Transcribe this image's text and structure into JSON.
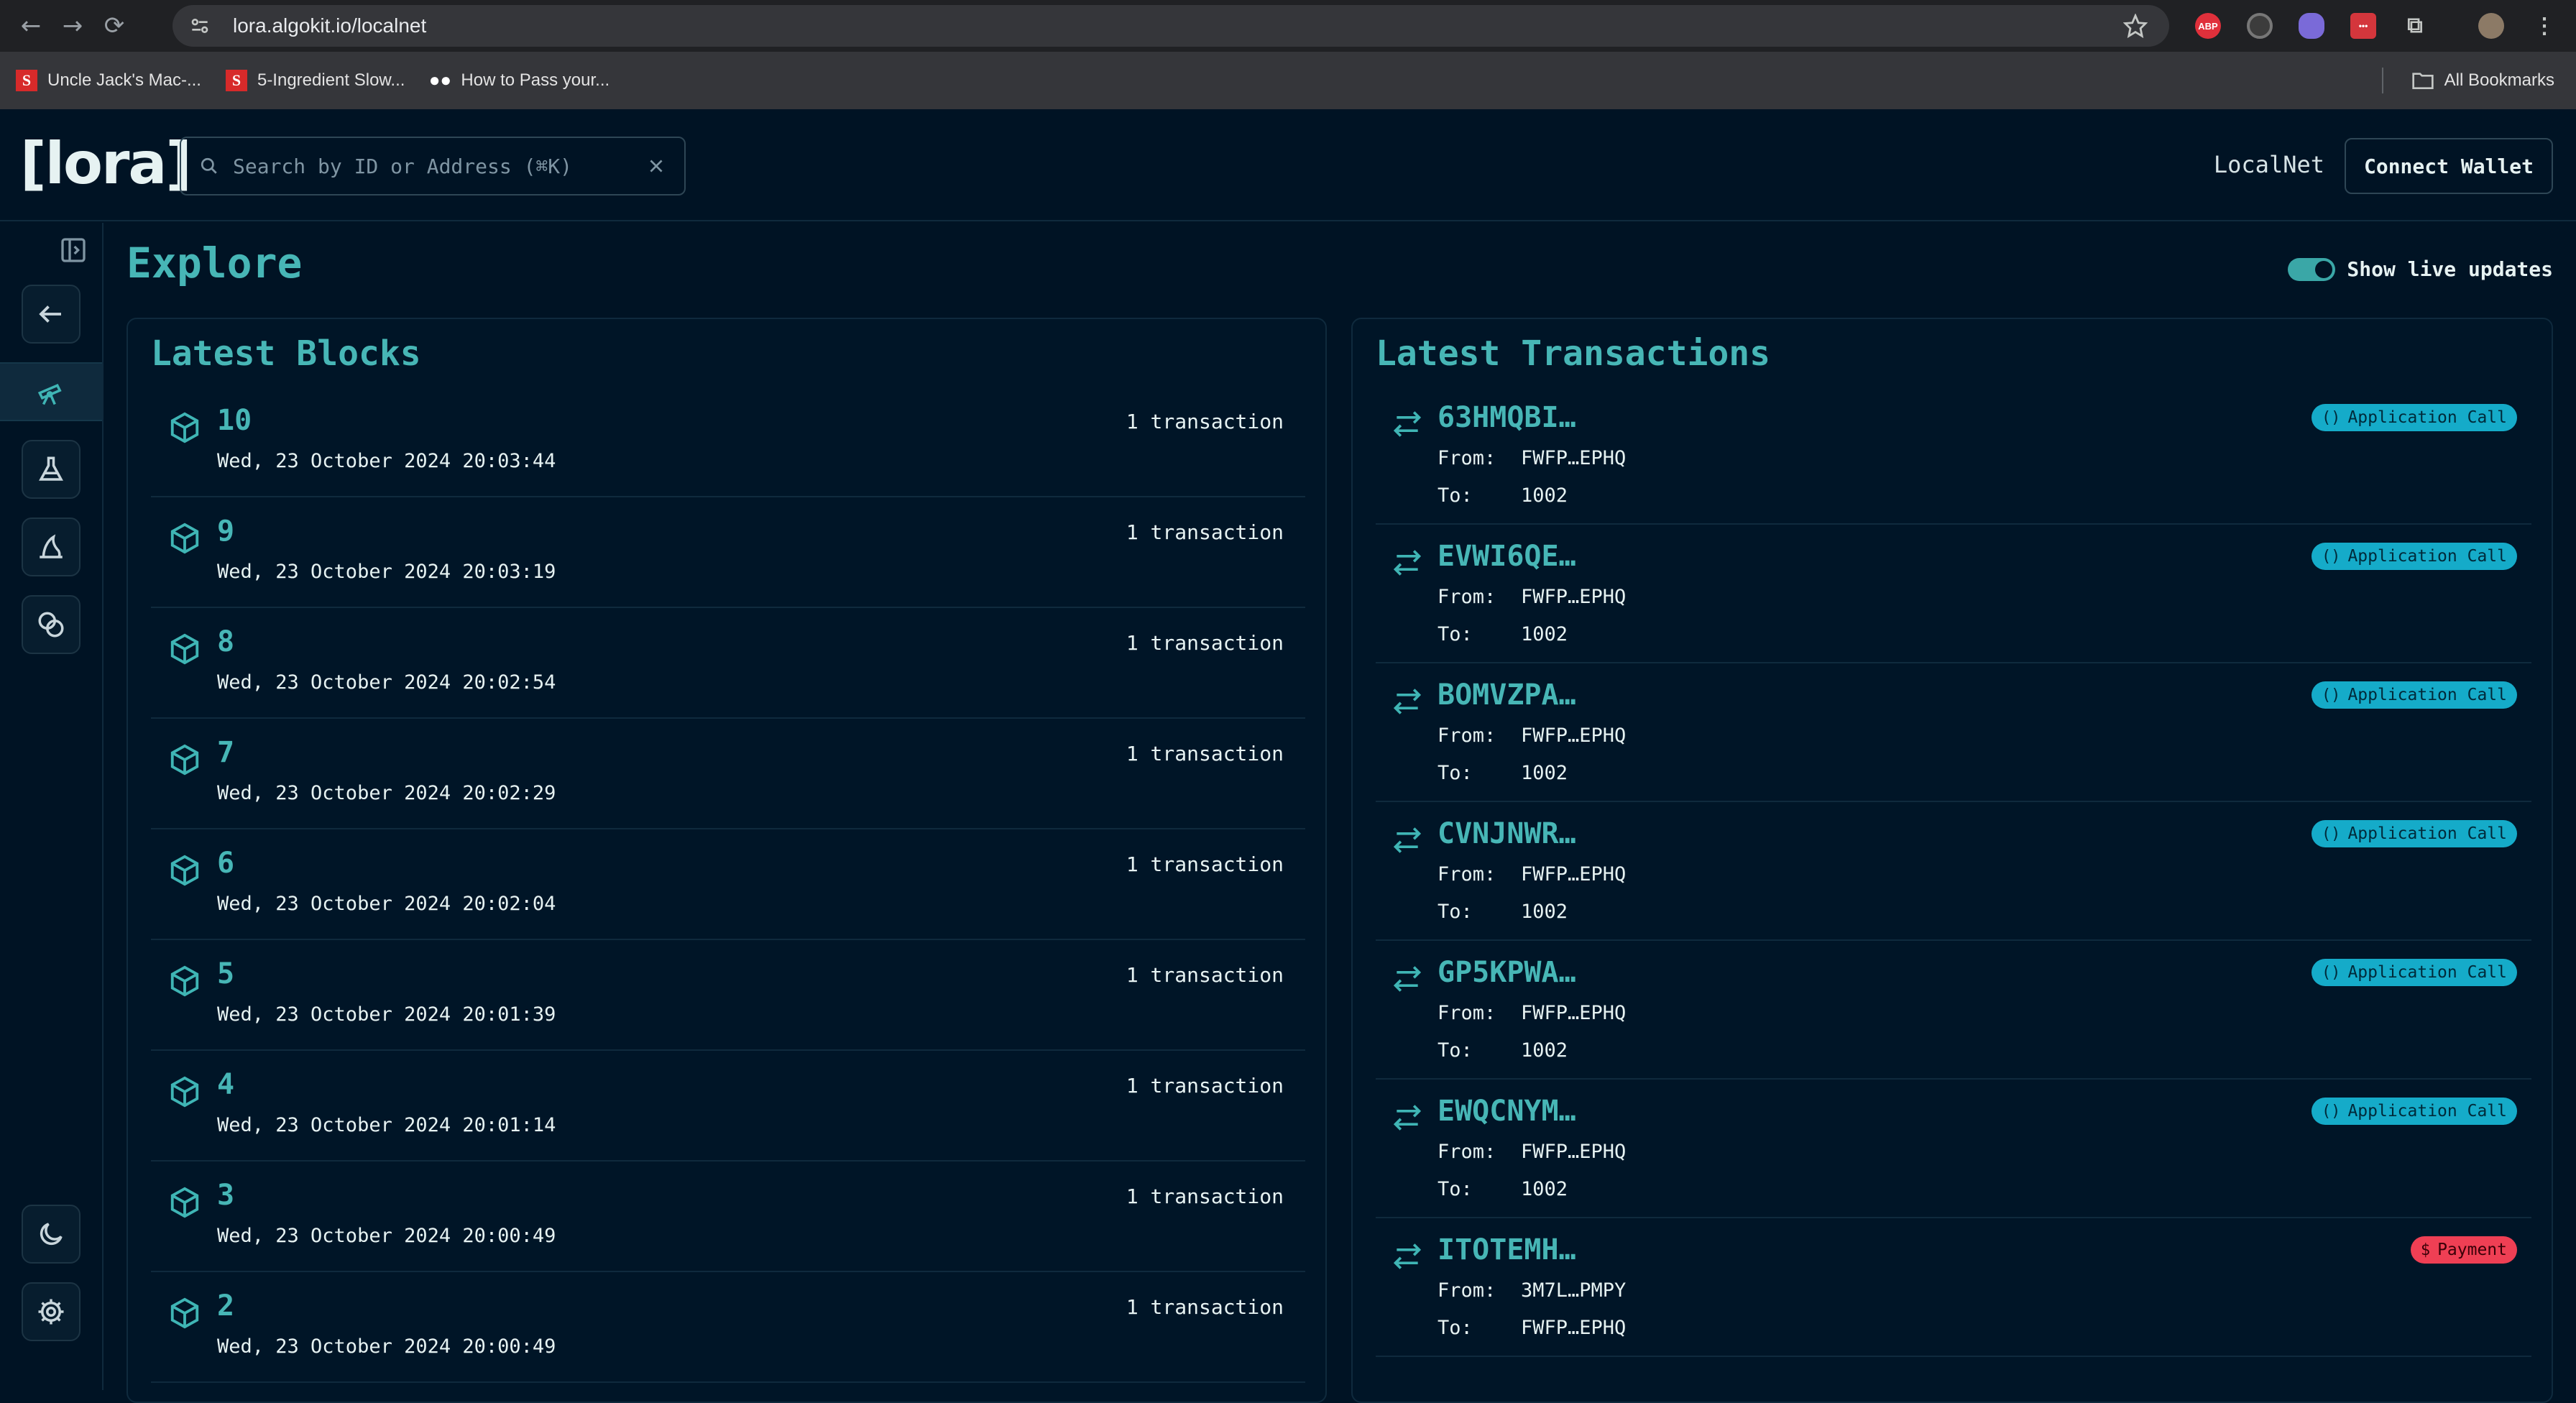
{
  "browser": {
    "url": "lora.algokit.io/localnet",
    "bookmarks": [
      {
        "label": "Uncle Jack's Mac-...",
        "icon": "SL"
      },
      {
        "label": "5-Ingredient Slow...",
        "icon": "SL"
      },
      {
        "label": "How to Pass your...",
        "icon": "medium"
      }
    ],
    "all_bookmarks": "All Bookmarks",
    "extensions": [
      "ABP",
      "dark-reader",
      "ghost",
      "ext-red",
      "puzzle"
    ]
  },
  "header": {
    "logo": "[lora]",
    "search_placeholder": "Search by ID or Address (⌘K)",
    "network": "LocalNet",
    "connect_label": "Connect Wallet"
  },
  "page": {
    "title": "Explore",
    "live_updates_label": "Show live updates",
    "live_updates_on": true
  },
  "blocks": {
    "title": "Latest Blocks",
    "items": [
      {
        "number": "10",
        "time": "Wed, 23 October 2024 20:03:44",
        "tx": "1 transaction"
      },
      {
        "number": "9",
        "time": "Wed, 23 October 2024 20:03:19",
        "tx": "1 transaction"
      },
      {
        "number": "8",
        "time": "Wed, 23 October 2024 20:02:54",
        "tx": "1 transaction"
      },
      {
        "number": "7",
        "time": "Wed, 23 October 2024 20:02:29",
        "tx": "1 transaction"
      },
      {
        "number": "6",
        "time": "Wed, 23 October 2024 20:02:04",
        "tx": "1 transaction"
      },
      {
        "number": "5",
        "time": "Wed, 23 October 2024 20:01:39",
        "tx": "1 transaction"
      },
      {
        "number": "4",
        "time": "Wed, 23 October 2024 20:01:14",
        "tx": "1 transaction"
      },
      {
        "number": "3",
        "time": "Wed, 23 October 2024 20:00:49",
        "tx": "1 transaction"
      },
      {
        "number": "2",
        "time": "Wed, 23 October 2024 20:00:49",
        "tx": "1 transaction"
      }
    ]
  },
  "transactions": {
    "title": "Latest Transactions",
    "from_label": "From:",
    "to_label": "To:",
    "items": [
      {
        "id": "63HMQBI…",
        "from": "FWFP…EPHQ",
        "to": "1002",
        "type": "Application Call",
        "kind": "app"
      },
      {
        "id": "EVWI6QE…",
        "from": "FWFP…EPHQ",
        "to": "1002",
        "type": "Application Call",
        "kind": "app"
      },
      {
        "id": "BOMVZPA…",
        "from": "FWFP…EPHQ",
        "to": "1002",
        "type": "Application Call",
        "kind": "app"
      },
      {
        "id": "CVNJNWR…",
        "from": "FWFP…EPHQ",
        "to": "1002",
        "type": "Application Call",
        "kind": "app"
      },
      {
        "id": "GP5KPWA…",
        "from": "FWFP…EPHQ",
        "to": "1002",
        "type": "Application Call",
        "kind": "app"
      },
      {
        "id": "EWQCNYM…",
        "from": "FWFP…EPHQ",
        "to": "1002",
        "type": "Application Call",
        "kind": "app"
      },
      {
        "id": "ITOTEMH…",
        "from": "3M7L…PMPY",
        "to": "FWFP…EPHQ",
        "type": "Payment",
        "kind": "pay"
      }
    ]
  },
  "colors": {
    "accent": "#47b6b6",
    "background": "#001324",
    "badge_app": "#15abc9",
    "badge_payment": "#ef3f54"
  }
}
